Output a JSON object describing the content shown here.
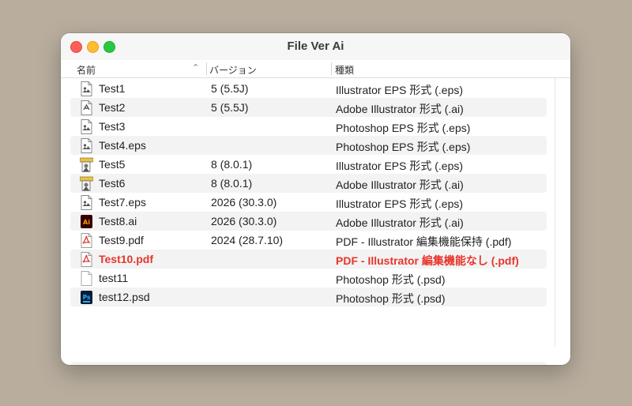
{
  "window": {
    "title": "File Ver Ai"
  },
  "columns": {
    "name": "名前",
    "version": "バージョン",
    "kind": "種類"
  },
  "rows": [
    {
      "name": "Test1",
      "version": "5 (5.5J)",
      "kind": "Illustrator EPS 形式 (.eps)",
      "icon": "eps-doc-icon"
    },
    {
      "name": "Test2",
      "version": "5 (5.5J)",
      "kind": "Adobe Illustrator 形式 (.ai)",
      "icon": "ai-doc-icon"
    },
    {
      "name": "Test3",
      "version": "",
      "kind": "Photoshop EPS 形式 (.eps)",
      "icon": "eps-doc-icon"
    },
    {
      "name": "Test4.eps",
      "version": "",
      "kind": "Photoshop EPS 形式 (.eps)",
      "icon": "eps-doc-icon"
    },
    {
      "name": "Test5",
      "version": "8 (8.0.1)",
      "kind": "Illustrator EPS 形式 (.eps)",
      "icon": "illustrator8-icon"
    },
    {
      "name": "Test6",
      "version": "8 (8.0.1)",
      "kind": "Adobe Illustrator 形式 (.ai)",
      "icon": "illustrator8-icon"
    },
    {
      "name": "Test7.eps",
      "version": "2026 (30.3.0)",
      "kind": "Illustrator EPS 形式 (.eps)",
      "icon": "eps-doc-icon"
    },
    {
      "name": "Test8.ai",
      "version": "2026 (30.3.0)",
      "kind": "Adobe Illustrator 形式 (.ai)",
      "icon": "ai-app-icon"
    },
    {
      "name": "Test9.pdf",
      "version": "2024 (28.7.10)",
      "kind": "PDF - Illustrator 編集機能保持 (.pdf)",
      "icon": "pdf-icon"
    },
    {
      "name": "Test10.pdf",
      "version": "",
      "kind": "PDF - Illustrator 編集機能なし (.pdf)",
      "icon": "pdf-icon",
      "highlight": true
    },
    {
      "name": "test11",
      "version": "",
      "kind": "Photoshop 形式 (.psd)",
      "icon": "blank-doc-icon"
    },
    {
      "name": "test12.psd",
      "version": "",
      "kind": "Photoshop 形式 (.psd)",
      "icon": "psd-icon"
    }
  ],
  "colors": {
    "highlight": "#e8352c",
    "background": "#b9ae9e"
  }
}
